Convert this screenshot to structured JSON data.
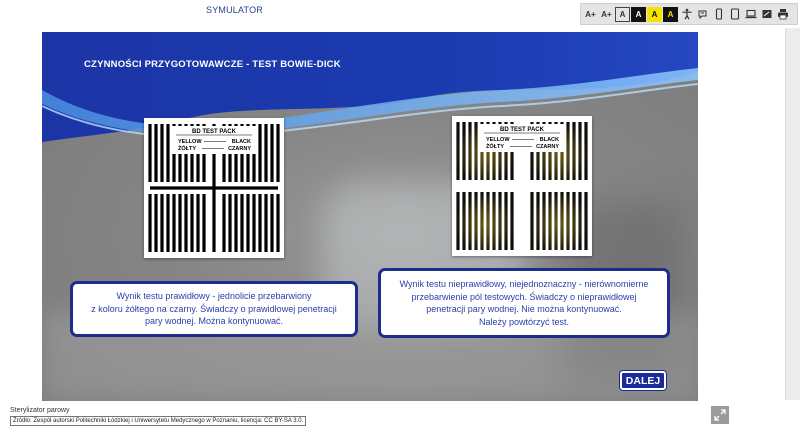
{
  "app": {
    "title": "SYMULATOR"
  },
  "accessibility_toolbar": {
    "buttons": [
      {
        "name": "font-increase-button",
        "label": "A+"
      },
      {
        "name": "font-decrease-button",
        "label": "A+"
      },
      {
        "name": "contrast-default-button",
        "label": "A"
      },
      {
        "name": "contrast-dark-button",
        "label": "A"
      },
      {
        "name": "contrast-yellow-button",
        "label": "A"
      },
      {
        "name": "contrast-yellow-dark-button",
        "label": "A"
      }
    ],
    "icons": [
      "accessibility-icon",
      "sign-language-icon",
      "phone-icon",
      "tablet-icon",
      "laptop-icon",
      "fullscreen-icon",
      "print-icon"
    ]
  },
  "slide": {
    "title": "CZYNNOŚCI PRZYGOTOWAWCZE - TEST BOWIE-DICK",
    "test_pack": {
      "title": "BD TEST PACK",
      "line1_left": "YELLOW",
      "line1_right": "BLACK",
      "line2_left": "ŻÓŁTY",
      "line2_right": "CZARNY"
    },
    "correct_result": {
      "lines": [
        "Wynik testu prawidłowy - jednolicie przebarwiony",
        "z koloru żółtego na czarny. Świadczy o prawidłowej penetracji",
        "pary wodnej. Można kontynuować."
      ]
    },
    "incorrect_result": {
      "lines": [
        "Wynik testu nieprawidłowy, niejednoznaczny - nierównomierne",
        "przebarwienie pól testowych. Świadczy o nieprawidłowej",
        "penetracji pary wodnej. Nie można kontynuować.",
        "Należy powtórzyć test."
      ]
    },
    "next_button": {
      "label": "DALEJ"
    }
  },
  "footer": {
    "caption": "Sterylizator parowy",
    "source": "Źródło: Zespół autorski Politechniki Łódzkiej i Uniwersytetu Medycznego w Poznaniu, licencja: CC BY-SA 3.0."
  },
  "colors": {
    "accent": "#1b2a9a",
    "header_blue": "#1e3aa8",
    "text_blue": "#2a3fa8",
    "toolbar_bg": "#e4e4e4"
  }
}
